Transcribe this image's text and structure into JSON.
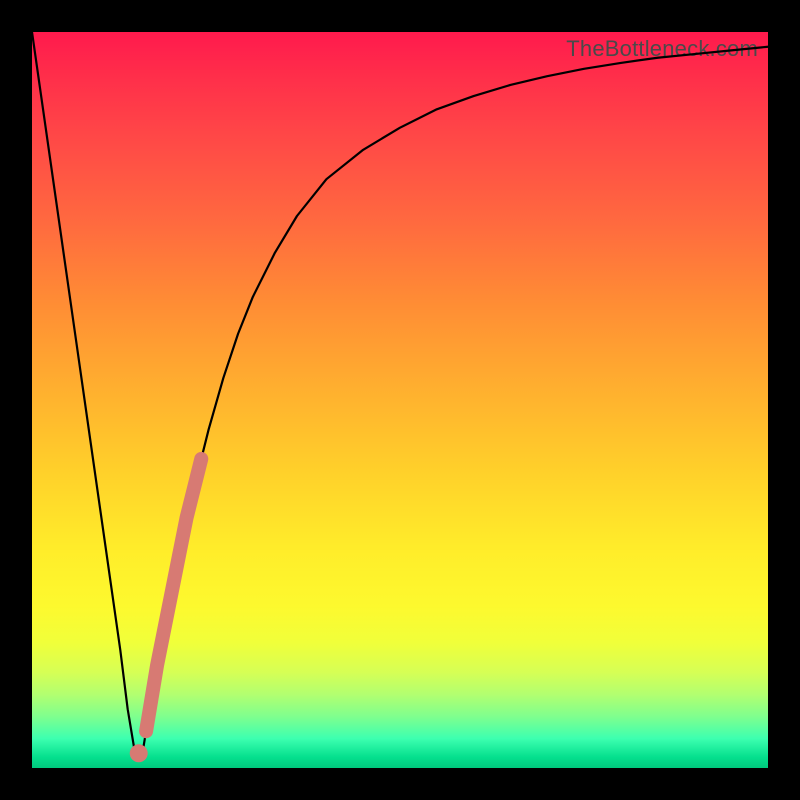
{
  "attribution": "TheBottleneck.com",
  "colors": {
    "frame": "#000000",
    "curve": "#000000",
    "thick_segment": "#d77a73",
    "dot": "#d77a73"
  },
  "chart_data": {
    "type": "line",
    "title": "",
    "xlabel": "",
    "ylabel": "",
    "xlim": [
      0,
      100
    ],
    "ylim": [
      0,
      100
    ],
    "annotations": [
      {
        "text": "TheBottleneck.com",
        "x": 99,
        "y": 99,
        "anchor": "top-right"
      }
    ],
    "series": [
      {
        "name": "bottleneck-curve",
        "style": "thin-black",
        "x": [
          0,
          2,
          4,
          6,
          8,
          10,
          12,
          13,
          14,
          15,
          16,
          18,
          20,
          22,
          24,
          26,
          28,
          30,
          33,
          36,
          40,
          45,
          50,
          55,
          60,
          65,
          70,
          75,
          80,
          85,
          90,
          95,
          100
        ],
        "y": [
          100,
          86,
          72,
          58,
          44,
          30,
          16,
          8,
          2,
          2,
          8,
          19,
          29,
          38,
          46,
          53,
          59,
          64,
          70,
          75,
          80,
          84,
          87,
          89.5,
          91.3,
          92.8,
          94,
          95,
          95.8,
          96.5,
          97,
          97.5,
          98
        ]
      },
      {
        "name": "highlight-segment",
        "style": "thick-salmon",
        "x": [
          15.5,
          16,
          17,
          18,
          19,
          20,
          21,
          22,
          23
        ],
        "y": [
          5,
          8,
          14,
          19,
          24,
          29,
          34,
          38,
          42
        ]
      }
    ],
    "markers": [
      {
        "name": "vertex-dot",
        "x": 14.5,
        "y": 2,
        "r": 1.2,
        "style": "salmon-dot"
      }
    ],
    "background_gradient": {
      "direction": "vertical",
      "stops": [
        {
          "pos": 0.0,
          "color": "#ff1a4d"
        },
        {
          "pos": 0.36,
          "color": "#ff8a35"
        },
        {
          "pos": 0.7,
          "color": "#ffec2a"
        },
        {
          "pos": 0.9,
          "color": "#b2ff70"
        },
        {
          "pos": 1.0,
          "color": "#00c97d"
        }
      ]
    }
  }
}
